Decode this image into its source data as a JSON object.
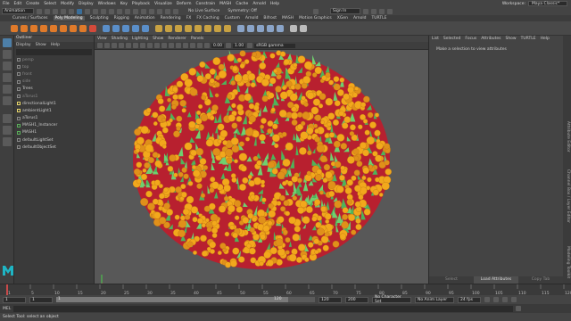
{
  "menubar": {
    "items": [
      "File",
      "Edit",
      "Create",
      "Select",
      "Modify",
      "Display",
      "Windows",
      "Key",
      "Playback",
      "Visualize",
      "Deform",
      "Constrain",
      "MASH",
      "Cache",
      "Arnold",
      "Help"
    ],
    "workspace_label": "Workspace:",
    "workspace_value": "Maya Classic*"
  },
  "status": {
    "mode": "Animation",
    "no_live_surface": "No Live Surface",
    "symmetry": "Symmetry: Off",
    "sign_in": "Sign In"
  },
  "shelf_tabs": [
    "Curves / Surfaces",
    "Poly Modeling",
    "Sculpting",
    "Rigging",
    "Animation",
    "Rendering",
    "FX",
    "FX Caching",
    "Custom",
    "Arnold",
    "Bifrost",
    "MASH",
    "Motion Graphics",
    "XGen",
    "Arnold",
    "TURTLE"
  ],
  "shelf_active": "Poly Modeling",
  "outliner": {
    "title": "Outliner",
    "menu": [
      "Display",
      "Show",
      "Help"
    ],
    "items": [
      "persp",
      "top",
      "front",
      "side",
      "Trees",
      "aTorus1",
      "directionalLight1",
      "ambientLight1",
      "aTorus1",
      "MASH1_Instancer",
      "MASH1",
      "defaultLightSet",
      "defaultObjectSet"
    ]
  },
  "viewport": {
    "menu": [
      "View",
      "Shading",
      "Lighting",
      "Show",
      "Renderer",
      "Panels"
    ],
    "toolbar": {
      "val1": "0.00",
      "val2": "1.00",
      "colorspace": "sRGB gamma"
    },
    "camera": "persp"
  },
  "attribute_editor": {
    "menu": [
      "List",
      "Selected",
      "Focus",
      "Attributes",
      "Show",
      "TURTLE",
      "Help"
    ],
    "message": "Make a selection to view attributes",
    "bottom_tabs": [
      "Select",
      "Load Attributes",
      "Copy Tab"
    ],
    "side_tabs": [
      "Attribute Editor",
      "Channel Box / Layer Editor",
      "Modeling Toolkit"
    ]
  },
  "timeline": {
    "ticks": [
      "1",
      "5",
      "10",
      "15",
      "20",
      "25",
      "30",
      "35",
      "40",
      "45",
      "50",
      "55",
      "60",
      "65",
      "70",
      "75",
      "80",
      "85",
      "90",
      "95",
      "100",
      "105",
      "110",
      "115",
      "120"
    ],
    "current": "1"
  },
  "range": {
    "start": "1",
    "inner_start": "1",
    "inner_end": "120",
    "end": "120",
    "anim_end": "200",
    "character_set": "No Character Set",
    "anim_layer": "No Anim Layer",
    "fps": "24 fps"
  },
  "cmdline": {
    "label": "MEL"
  },
  "helpline": {
    "text": "Select Tool: select an object"
  },
  "colors": {
    "ground": "#d9233f",
    "flower": "#f2a81c",
    "leaf": "#6fd06f",
    "bg": "#585858"
  }
}
